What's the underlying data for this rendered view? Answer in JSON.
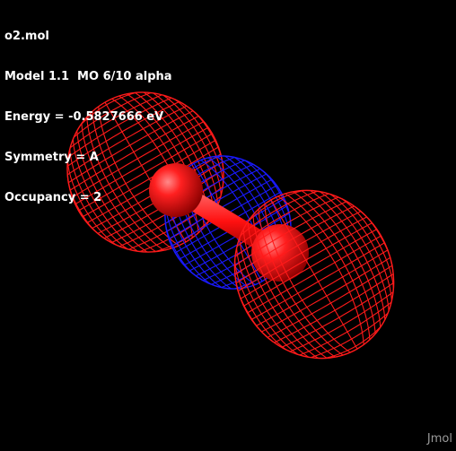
{
  "info": {
    "file": "o2.mol",
    "model_line": "Model 1.1  MO 6/10 alpha",
    "energy_line": "Energy = -0.5827666 eV",
    "symmetry_line": "Symmetry = A",
    "occupancy_line": "Occupancy = 2"
  },
  "watermark": "Jmol",
  "colors": {
    "background": "#000000",
    "positive_lobe": "#ff1a1a",
    "negative_lobe": "#1a1aff",
    "atom": "#ff0000",
    "text": "#ffffff",
    "watermark": "#9a9a9a"
  }
}
